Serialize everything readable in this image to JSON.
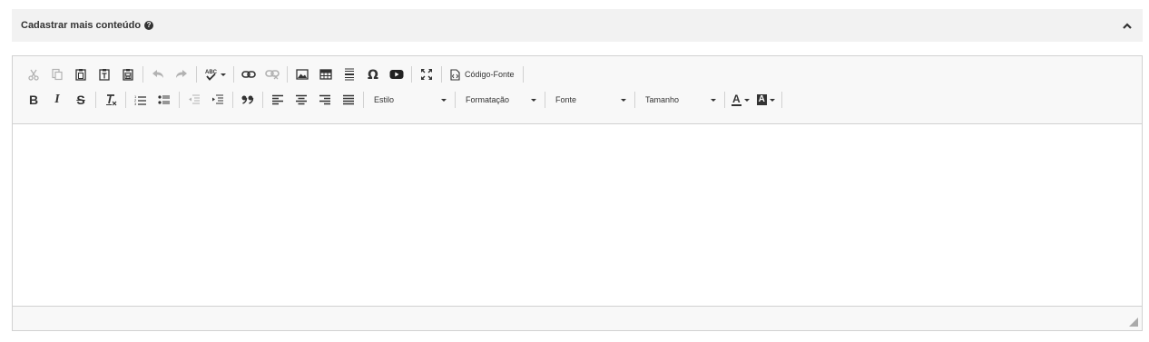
{
  "panel": {
    "title": "Cadastrar mais conteúdo",
    "help_glyph": "?"
  },
  "toolbar": {
    "source_label": "Código-Fonte",
    "bold_label": "B",
    "italic_label": "I",
    "strike_label": "S",
    "style_combo": "Estilo",
    "format_combo": "Formatação",
    "font_combo": "Fonte",
    "size_combo": "Tamanho",
    "text_color_label": "A",
    "bg_color_label": "A"
  },
  "colors": {
    "header_bg": "#f2f2f2",
    "toolbar_bg": "#f8f8f8",
    "border": "#d1d1d1",
    "icon": "#333333"
  }
}
